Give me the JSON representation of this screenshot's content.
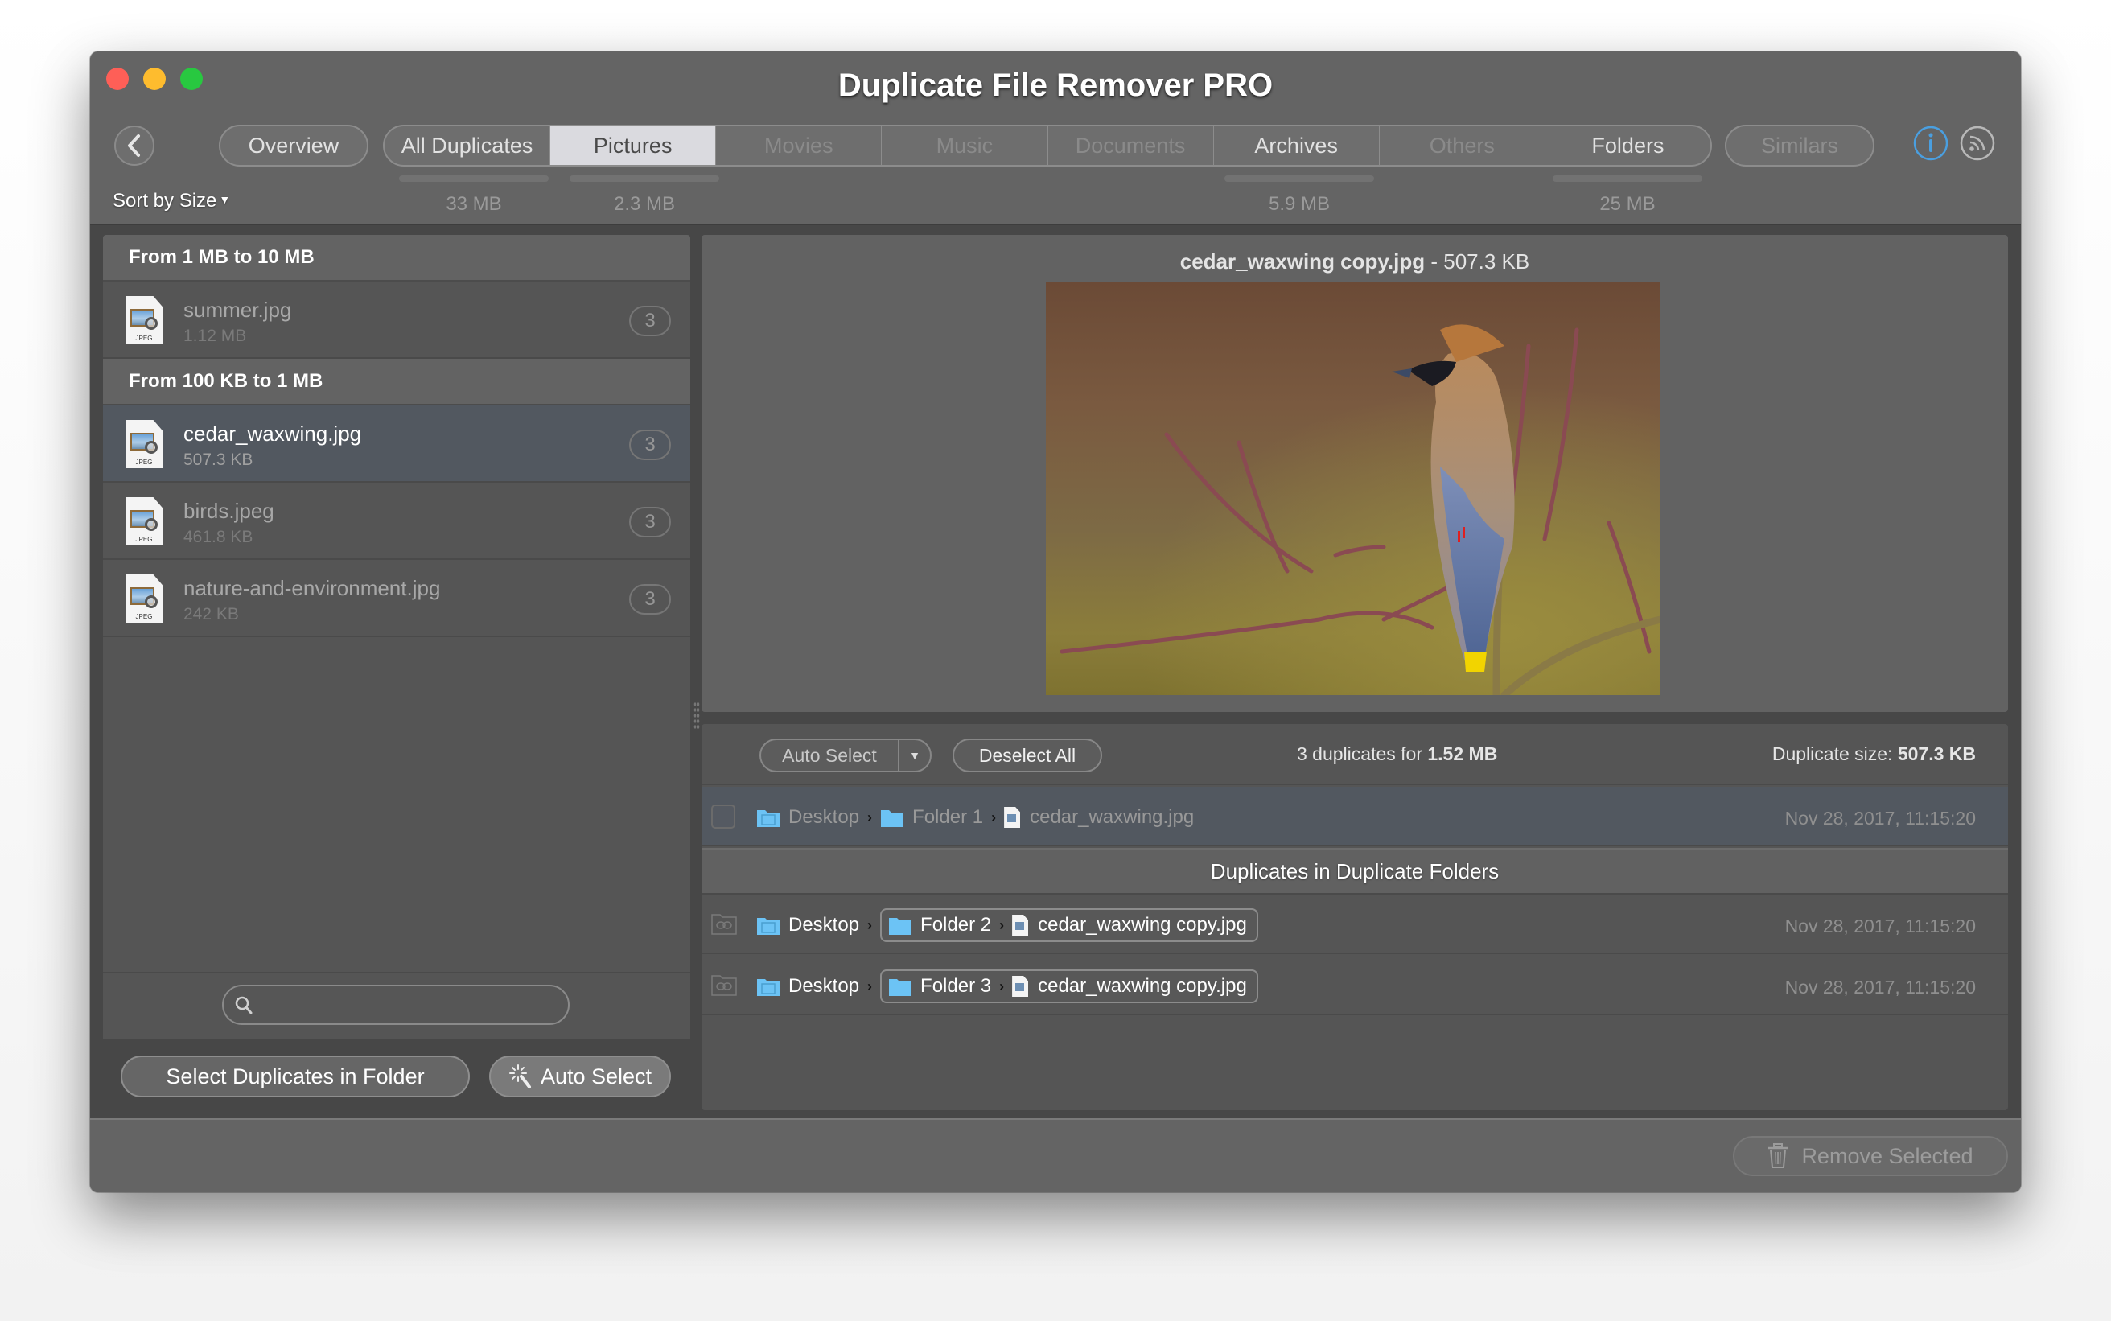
{
  "window": {
    "title": "Duplicate File Remover PRO",
    "controls": [
      "close",
      "minimize",
      "zoom"
    ]
  },
  "toolbar": {
    "back_icon": "chevron-left-icon",
    "overview_label": "Overview",
    "tabs": [
      {
        "label": "All Duplicates",
        "state": "enabled",
        "size": "33 MB"
      },
      {
        "label": "Pictures",
        "state": "active",
        "size": "2.3 MB"
      },
      {
        "label": "Movies",
        "state": "disabled",
        "size": ""
      },
      {
        "label": "Music",
        "state": "disabled",
        "size": ""
      },
      {
        "label": "Documents",
        "state": "disabled",
        "size": ""
      },
      {
        "label": "Archives",
        "state": "enabled",
        "size": "5.9 MB"
      },
      {
        "label": "Others",
        "state": "disabled",
        "size": ""
      },
      {
        "label": "Folders",
        "state": "enabled",
        "size": "25 MB"
      }
    ],
    "similars_label": "Similars",
    "info_icon": "info-icon",
    "rss_icon": "rss-icon",
    "sort_label": "Sort by Size"
  },
  "file_list": {
    "groups": [
      {
        "header": "From 1 MB to 10 MB",
        "files": [
          {
            "name": "summer.jpg",
            "size": "1.12 MB",
            "count": "3",
            "type": "JPEG",
            "selected": false
          }
        ]
      },
      {
        "header": "From 100 KB to 1 MB",
        "files": [
          {
            "name": "cedar_waxwing.jpg",
            "size": "507.3 KB",
            "count": "3",
            "type": "JPEG",
            "selected": true
          },
          {
            "name": "birds.jpeg",
            "size": "461.8 KB",
            "count": "3",
            "type": "JPEG",
            "selected": false
          },
          {
            "name": "nature-and-environment.jpg",
            "size": "242 KB",
            "count": "3",
            "type": "JPEG",
            "selected": false
          }
        ]
      }
    ],
    "search": {
      "value": "",
      "placeholder": ""
    },
    "select_in_folder_label": "Select Duplicates in Folder",
    "auto_select_label": "Auto Select"
  },
  "preview": {
    "filename": "cedar_waxwing copy.jpg",
    "separator": " - ",
    "size": "507.3 KB",
    "image_subject": "cedar waxwing bird perched on branch"
  },
  "duplicates": {
    "auto_select_label": "Auto Select",
    "deselect_all_label": "Deselect All",
    "summary_prefix": "3 duplicates for ",
    "summary_value": "1.52 MB",
    "dup_size_prefix": "Duplicate size: ",
    "dup_size_value": "507.3 KB",
    "original": {
      "path": [
        "Desktop",
        "Folder 1",
        "cedar_waxwing.jpg"
      ],
      "timestamp": "Nov 28, 2017, 11:15:20",
      "checked": false
    },
    "section_header": "Duplicates in Duplicate Folders",
    "rows": [
      {
        "path": [
          "Desktop",
          "Folder 2",
          "cedar_waxwing copy.jpg"
        ],
        "timestamp": "Nov 28, 2017, 11:15:20"
      },
      {
        "path": [
          "Desktop",
          "Folder 3",
          "cedar_waxwing copy.jpg"
        ],
        "timestamp": "Nov 28, 2017, 11:15:20"
      }
    ]
  },
  "footer": {
    "remove_label": "Remove Selected",
    "remove_enabled": false
  },
  "colors": {
    "accent_info": "#4a9fe0",
    "folder_blue": "#6cc3f5",
    "selected_row": "#525860",
    "active_tab": "#dadadf"
  }
}
